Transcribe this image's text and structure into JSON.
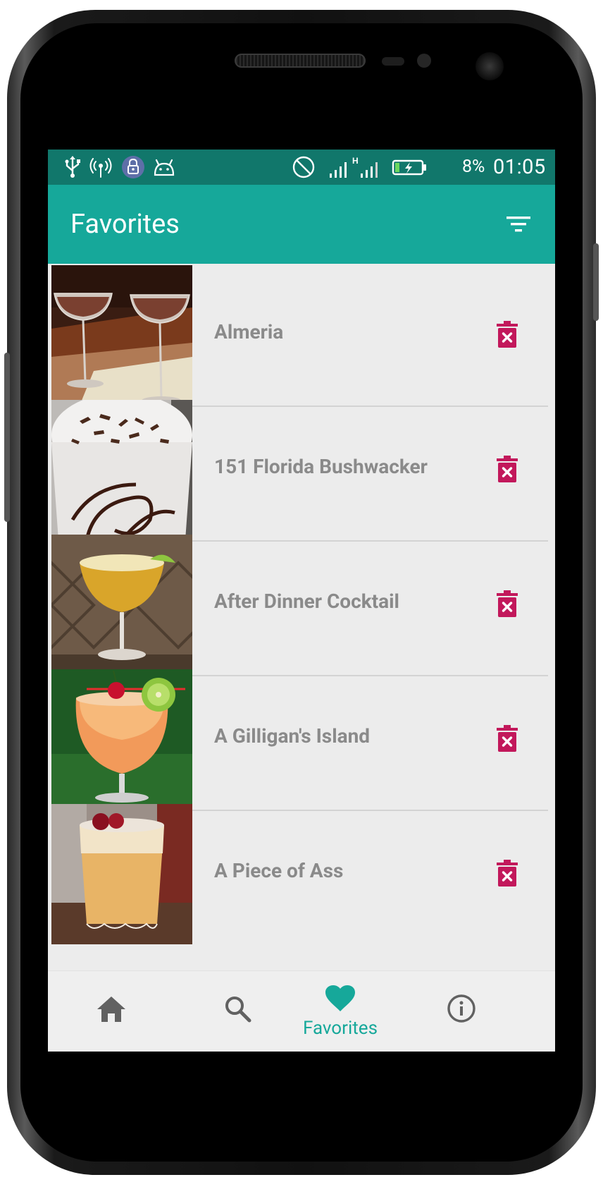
{
  "status_bar": {
    "battery_percent": "8%",
    "time": "01:05",
    "network_type": "H",
    "icons": [
      "usb-icon",
      "wireless-icon",
      "lock-icon",
      "android-debug-icon",
      "do-not-disturb-icon",
      "signal-icon",
      "battery-charging-icon"
    ]
  },
  "app_bar": {
    "title": "Favorites",
    "filter_icon": "filter-list-icon"
  },
  "favorites": [
    {
      "name": "Almeria",
      "delete_icon": "delete-forever-icon"
    },
    {
      "name": "151 Florida Bushwacker",
      "delete_icon": "delete-forever-icon"
    },
    {
      "name": "After Dinner Cocktail",
      "delete_icon": "delete-forever-icon"
    },
    {
      "name": "A Gilligan's Island",
      "delete_icon": "delete-forever-icon"
    },
    {
      "name": "A Piece of Ass",
      "delete_icon": "delete-forever-icon"
    }
  ],
  "bottom_nav": {
    "items": [
      {
        "icon": "home-icon",
        "label": "",
        "active": false
      },
      {
        "icon": "search-icon",
        "label": "",
        "active": false
      },
      {
        "icon": "heart-icon",
        "label": "Favorites",
        "active": true
      },
      {
        "icon": "info-icon",
        "label": "",
        "active": false
      }
    ]
  },
  "colors": {
    "status_bar": "#11776b",
    "app_bar": "#16a89a",
    "accent": "#16a89a",
    "delete": "#c2185b",
    "list_bg": "#ececec",
    "item_text": "#8a8a8a",
    "nav_icon_inactive": "#616161"
  }
}
